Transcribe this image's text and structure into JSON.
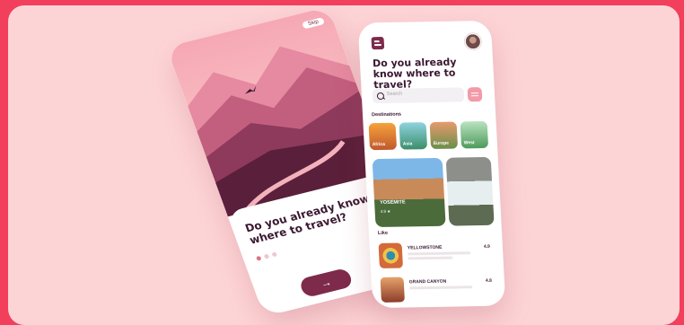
{
  "onboarding": {
    "skip_label": "Skip",
    "title": "Do you already know where to travel?",
    "next_icon": "arrow-right-icon"
  },
  "home": {
    "title": "Do you already know where to travel?",
    "search_placeholder": "Search",
    "destinations_label": "Destinations",
    "destinations": [
      {
        "label": "Africa"
      },
      {
        "label": "Asia"
      },
      {
        "label": "Europe"
      },
      {
        "label": "West"
      }
    ],
    "featured": {
      "name": "YOSEMITE",
      "rating": "4.9 ★"
    },
    "list_label": "Like",
    "list": [
      {
        "name": "YELLOWSTONE",
        "rating": "4.9"
      },
      {
        "name": "GRAND CANYON",
        "rating": "4.8"
      }
    ]
  },
  "colors": {
    "accent": "#7e2a4b",
    "background": "#fdd4d6",
    "frame": "#f23f5c",
    "pink": "#f39aa9"
  }
}
